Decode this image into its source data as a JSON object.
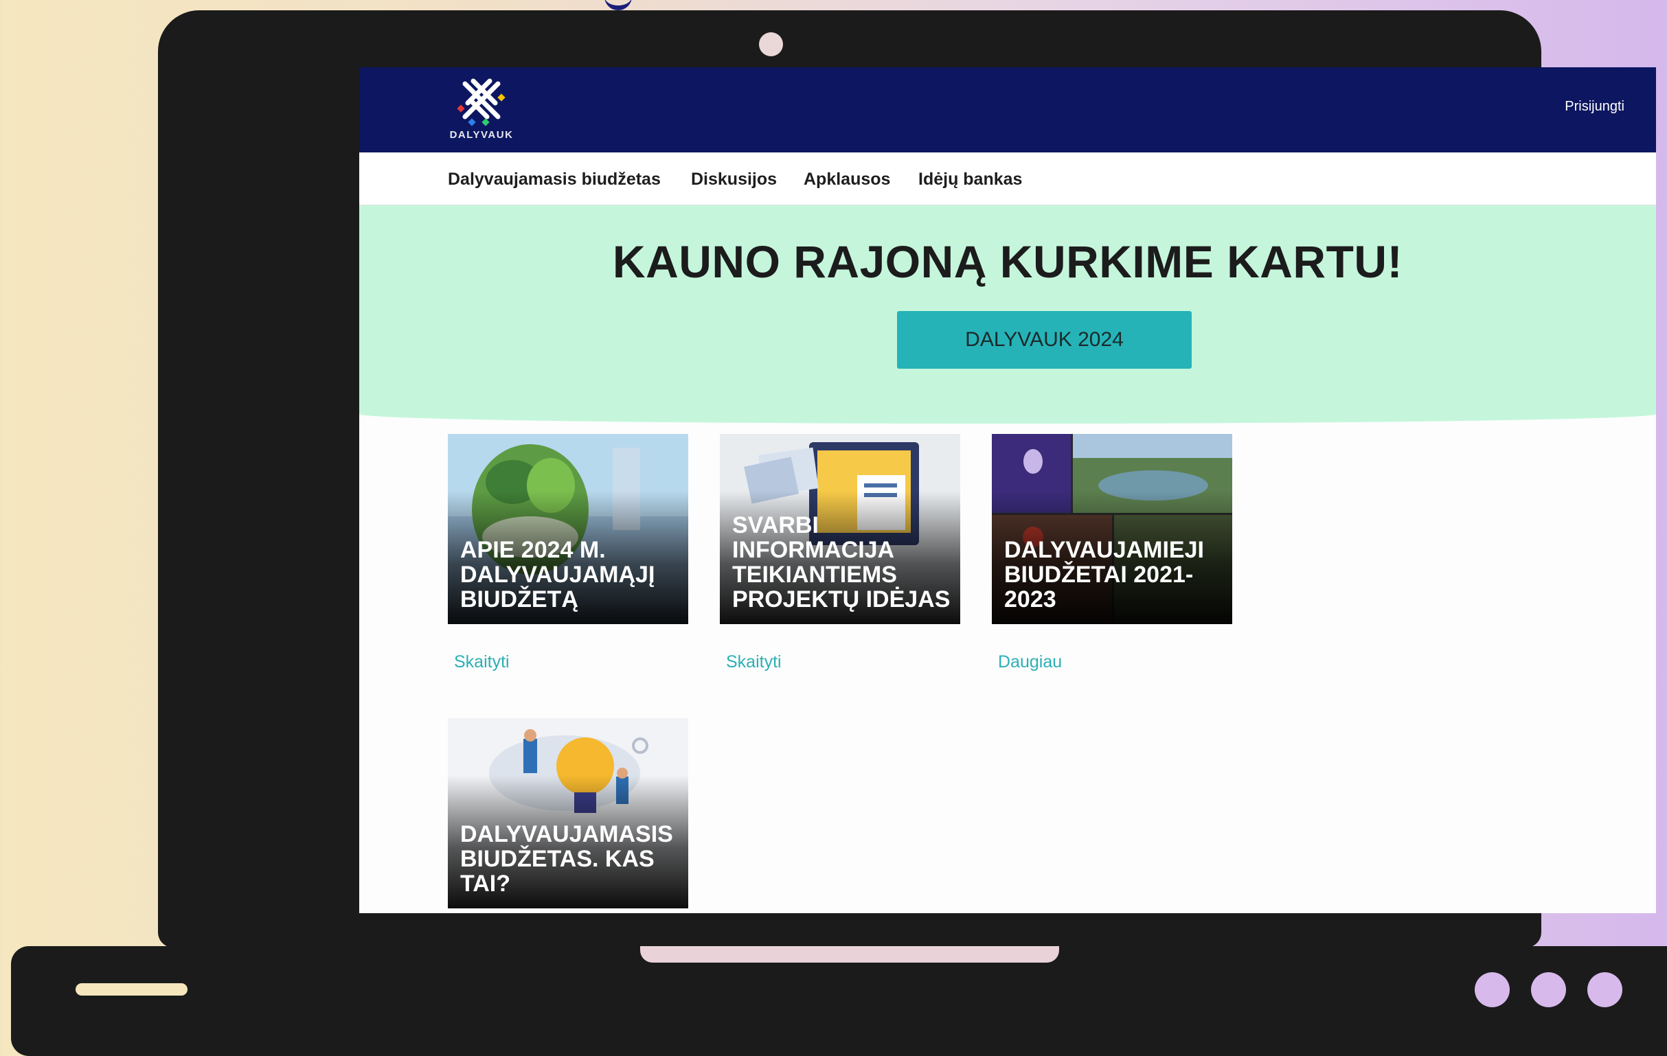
{
  "header": {
    "logo_text": "DALYVAUK",
    "login_label": "Prisijungti"
  },
  "nav": {
    "items": [
      {
        "label": "Dalyvaujamasis biudžetas"
      },
      {
        "label": "Diskusijos"
      },
      {
        "label": "Apklausos"
      },
      {
        "label": "Idėjų bankas"
      }
    ]
  },
  "hero": {
    "title": "KAUNO RAJONĄ KURKIME KARTU!",
    "cta_label": "DALYVAUK 2024"
  },
  "cards": [
    {
      "title": "APIE 2024 M. DALYVAUJAMĄJĮ BIUDŽETĄ",
      "link": "Skaityti"
    },
    {
      "title": "SVARBI INFORMACIJA TEIKIANTIEMS PROJEKTŲ IDĖJAS",
      "link": "Skaityti"
    },
    {
      "title": "DALYVAUJAMIEJI BIUDŽETAI 2021-2023",
      "link": "Daugiau"
    },
    {
      "title": "DALYVAUJAMASIS BIUDŽETAS. KAS TAI?",
      "link": ""
    }
  ],
  "colors": {
    "header_bg": "#0d1660",
    "hero_bg": "#c5f6dc",
    "accent": "#26b3b8",
    "link": "#2bb0b5"
  }
}
